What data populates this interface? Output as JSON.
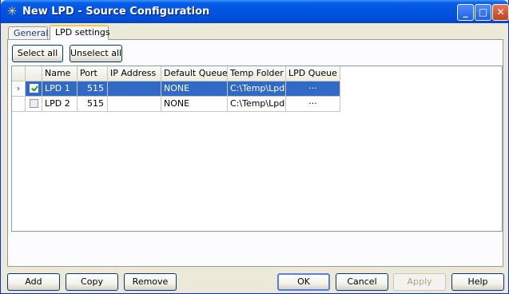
{
  "window": {
    "title": "New LPD - Source Configuration",
    "app_icon": "star-icon",
    "controls": {
      "minimize": "minimize-icon",
      "maximize": "maximize-icon",
      "close": "close-icon"
    }
  },
  "tabs": [
    {
      "label": "General",
      "active": false
    },
    {
      "label": "LPD settings",
      "active": true
    }
  ],
  "toolbar": {
    "select_all": "Select all",
    "unselect_all": "Unselect all"
  },
  "grid": {
    "columns": [
      "Name",
      "Port",
      "IP Address",
      "Default Queue",
      "Temp Folder",
      "LPD Queue"
    ],
    "rows": [
      {
        "checked": true,
        "name": "LPD 1",
        "port": "515",
        "ip": "",
        "default_queue": "NONE",
        "temp_folder": "C:\\Temp\\LpdRx",
        "lpd_queue": "···",
        "selected": true
      },
      {
        "checked": false,
        "name": "LPD 2",
        "port": "515",
        "ip": "",
        "default_queue": "NONE",
        "temp_folder": "C:\\Temp\\LpdRx",
        "lpd_queue": "···",
        "selected": false
      }
    ],
    "selection_color": "#316ac5"
  },
  "footer": {
    "add": "Add",
    "copy": "Copy",
    "remove": "Remove",
    "ok": "OK",
    "cancel": "Cancel",
    "apply": "Apply",
    "help": "Help"
  }
}
